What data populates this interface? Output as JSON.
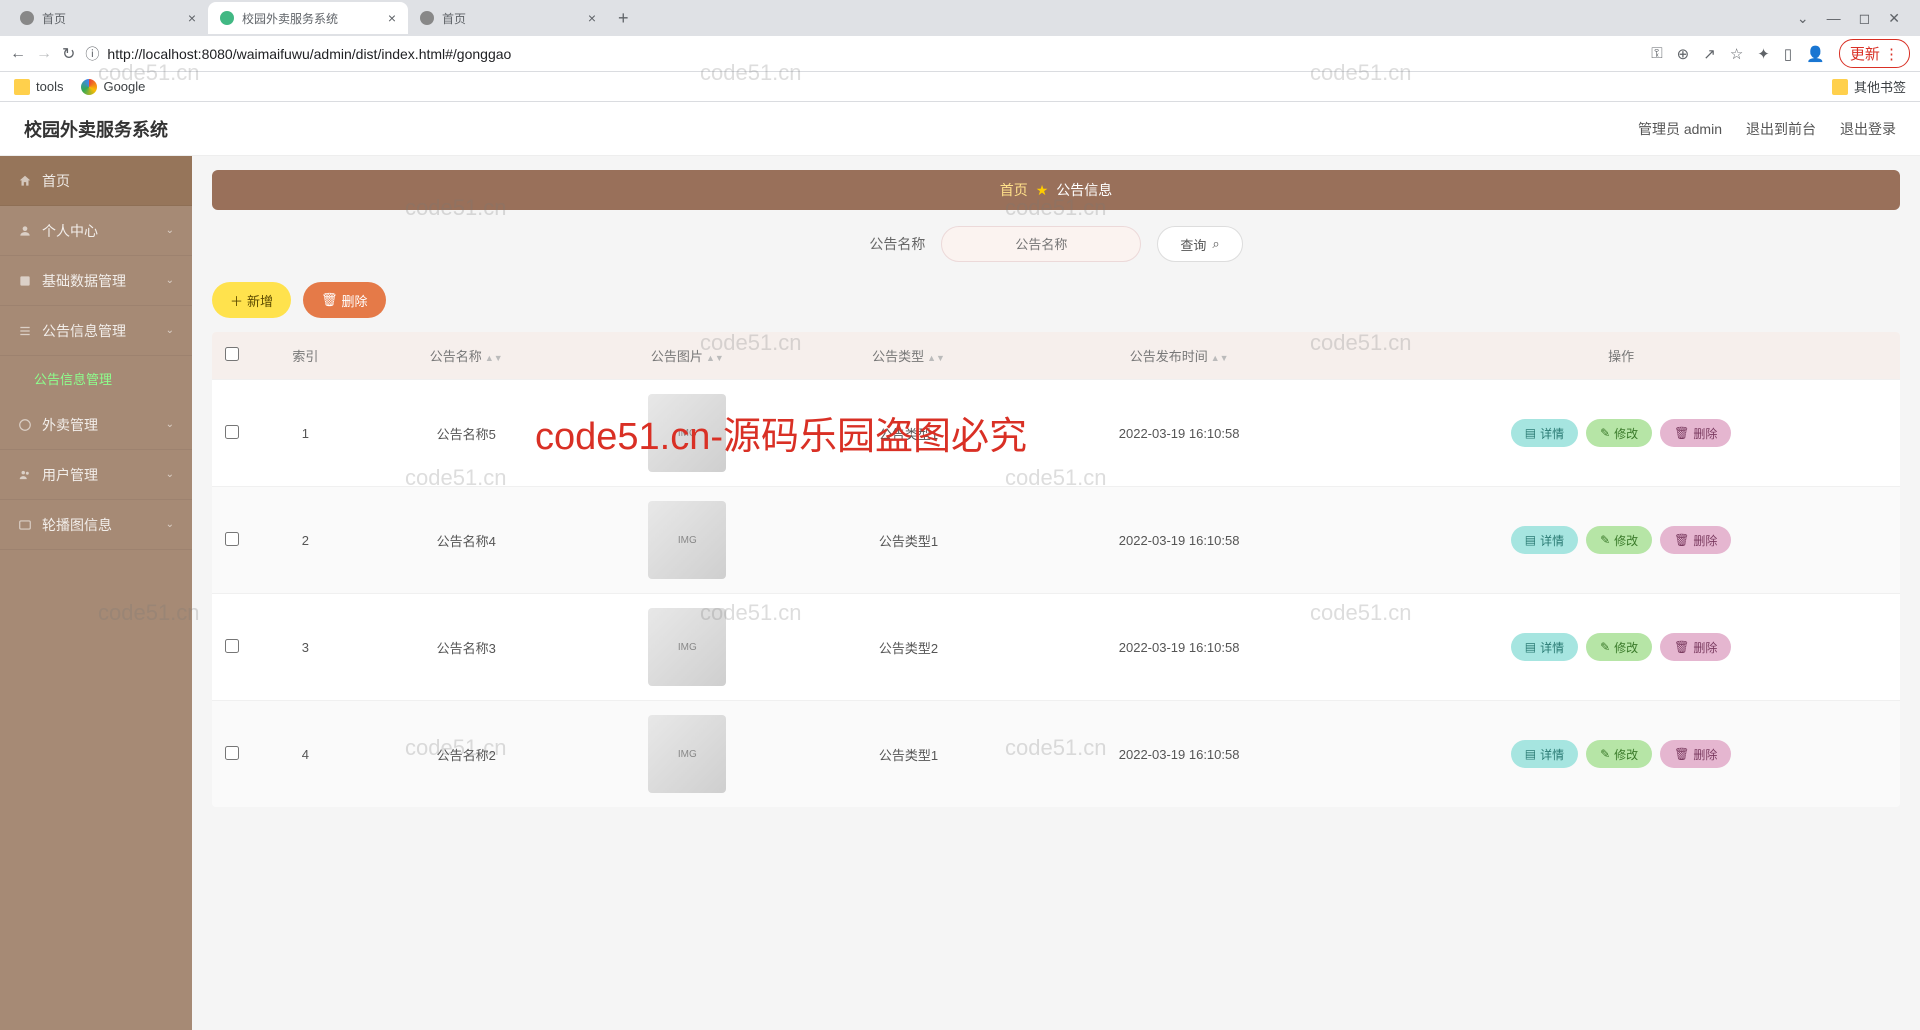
{
  "browser": {
    "tabs": [
      {
        "title": "首页",
        "active": false
      },
      {
        "title": "校园外卖服务系统",
        "active": true
      },
      {
        "title": "首页",
        "active": false
      }
    ],
    "url": "http://localhost:8080/waimaifuwu/admin/dist/index.html#/gonggao",
    "update_btn": "更新",
    "bookmarks": {
      "tools": "tools",
      "google": "Google",
      "other": "其他书签"
    }
  },
  "app": {
    "title": "校园外卖服务系统",
    "header_right": {
      "admin": "管理员 admin",
      "front": "退出到前台",
      "logout": "退出登录"
    }
  },
  "sidebar": {
    "items": [
      {
        "label": "首页",
        "icon": "home"
      },
      {
        "label": "个人中心",
        "icon": "user"
      },
      {
        "label": "基础数据管理",
        "icon": "data"
      },
      {
        "label": "公告信息管理",
        "icon": "list",
        "expanded": true,
        "children": [
          {
            "label": "公告信息管理",
            "active": true
          }
        ]
      },
      {
        "label": "外卖管理",
        "icon": "takeout"
      },
      {
        "label": "用户管理",
        "icon": "users"
      },
      {
        "label": "轮播图信息",
        "icon": "image"
      }
    ]
  },
  "breadcrumb": {
    "home": "首页",
    "current": "公告信息"
  },
  "search": {
    "label": "公告名称",
    "placeholder": "公告名称",
    "button": "查询"
  },
  "actions": {
    "add": "新增",
    "delete": "删除"
  },
  "table": {
    "columns": {
      "index": "索引",
      "name": "公告名称",
      "image": "公告图片",
      "type": "公告类型",
      "time": "公告发布时间",
      "ops": "操作"
    },
    "ops": {
      "detail": "详情",
      "edit": "修改",
      "delete": "删除"
    },
    "rows": [
      {
        "idx": "1",
        "name": "公告名称5",
        "type": "公告类型1",
        "time": "2022-03-19 16:10:58"
      },
      {
        "idx": "2",
        "name": "公告名称4",
        "type": "公告类型1",
        "time": "2022-03-19 16:10:58"
      },
      {
        "idx": "3",
        "name": "公告名称3",
        "type": "公告类型2",
        "time": "2022-03-19 16:10:58"
      },
      {
        "idx": "4",
        "name": "公告名称2",
        "type": "公告类型1",
        "time": "2022-03-19 16:10:58"
      }
    ]
  },
  "watermark": {
    "main": "code51.cn-源码乐园盗图必究",
    "small": "code51.cn"
  }
}
